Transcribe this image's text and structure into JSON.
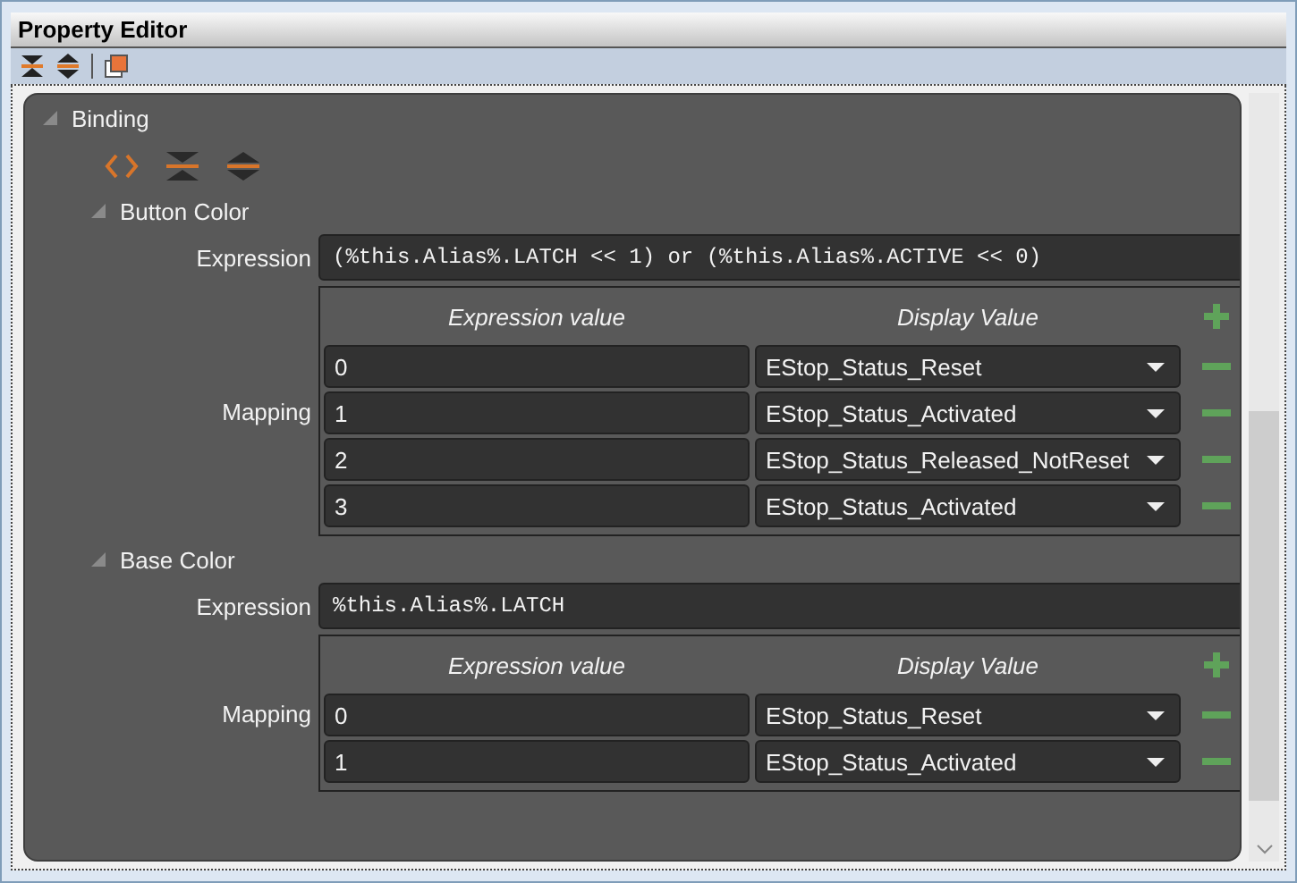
{
  "window": {
    "title": "Property Editor"
  },
  "binding": {
    "label": "Binding",
    "expanded": true,
    "properties": [
      {
        "label": "Button Color",
        "expanded": true,
        "expression_label": "Expression",
        "expression": "(%this.Alias%.LATCH << 1) or (%this.Alias%.ACTIVE << 0)",
        "mapping_label": "Mapping",
        "columns": [
          "Expression value",
          "Display Value"
        ],
        "rows": [
          {
            "value": "0",
            "display": "EStop_Status_Reset"
          },
          {
            "value": "1",
            "display": "EStop_Status_Activated"
          },
          {
            "value": "2",
            "display": "EStop_Status_Released_NotReset"
          },
          {
            "value": "3",
            "display": "EStop_Status_Activated"
          }
        ]
      },
      {
        "label": "Base Color",
        "expanded": true,
        "expression_label": "Expression",
        "expression": "%this.Alias%.LATCH",
        "mapping_label": "Mapping",
        "columns": [
          "Expression value",
          "Display Value"
        ],
        "rows": [
          {
            "value": "0",
            "display": "EStop_Status_Reset"
          },
          {
            "value": "1",
            "display": "EStop_Status_Activated"
          }
        ]
      }
    ]
  }
}
